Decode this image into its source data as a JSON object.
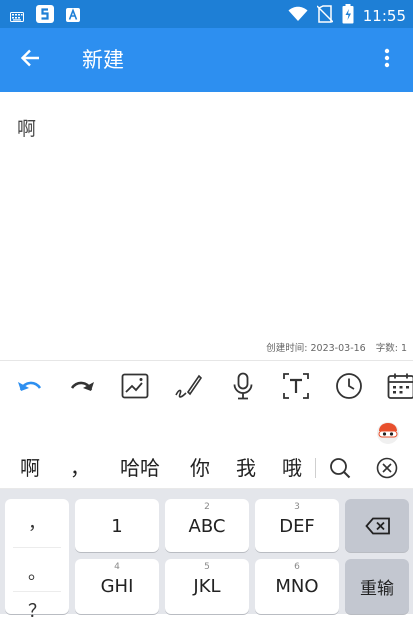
{
  "status_bar": {
    "left_icons": [
      "keyboard-icon",
      "s-app-icon",
      "a-app-icon"
    ],
    "right_icons": [
      "wifi-icon",
      "no-sim-icon",
      "battery-charging-icon"
    ],
    "time": "11:55"
  },
  "app_bar": {
    "title": "新建",
    "back_icon": "arrow-left-icon",
    "menu_icon": "more-vert-icon"
  },
  "editor": {
    "content": "啊",
    "created_label": "创建时间:",
    "created_date": "2023-03-16",
    "word_count_label": "字数:",
    "word_count": "1"
  },
  "toolbar": {
    "icons": [
      "undo-icon",
      "redo-icon",
      "image-icon",
      "handwriting-icon",
      "microphone-icon",
      "text-box-icon",
      "clock-icon",
      "calendar-icon"
    ]
  },
  "ime": {
    "candidates": [
      "啊",
      "，",
      "哈哈",
      "你",
      "我",
      "哦"
    ],
    "search_icon": "search-icon",
    "close_icon": "close-circle-icon",
    "logo_icon": "ime-logo-icon"
  },
  "keyboard": {
    "punctuation": [
      "，",
      "。",
      "？"
    ],
    "keys_row1": [
      {
        "num": "",
        "label": "1"
      },
      {
        "num": "2",
        "label": "ABC"
      },
      {
        "num": "3",
        "label": "DEF"
      }
    ],
    "keys_row2": [
      {
        "num": "4",
        "label": "GHI"
      },
      {
        "num": "5",
        "label": "JKL"
      },
      {
        "num": "6",
        "label": "MNO"
      }
    ],
    "backspace_icon": "backspace-icon",
    "enter_label": "重输"
  },
  "colors": {
    "status_bar": "#1e7fd6",
    "app_bar": "#2d8ff0",
    "accent": "#2d8ff0"
  }
}
